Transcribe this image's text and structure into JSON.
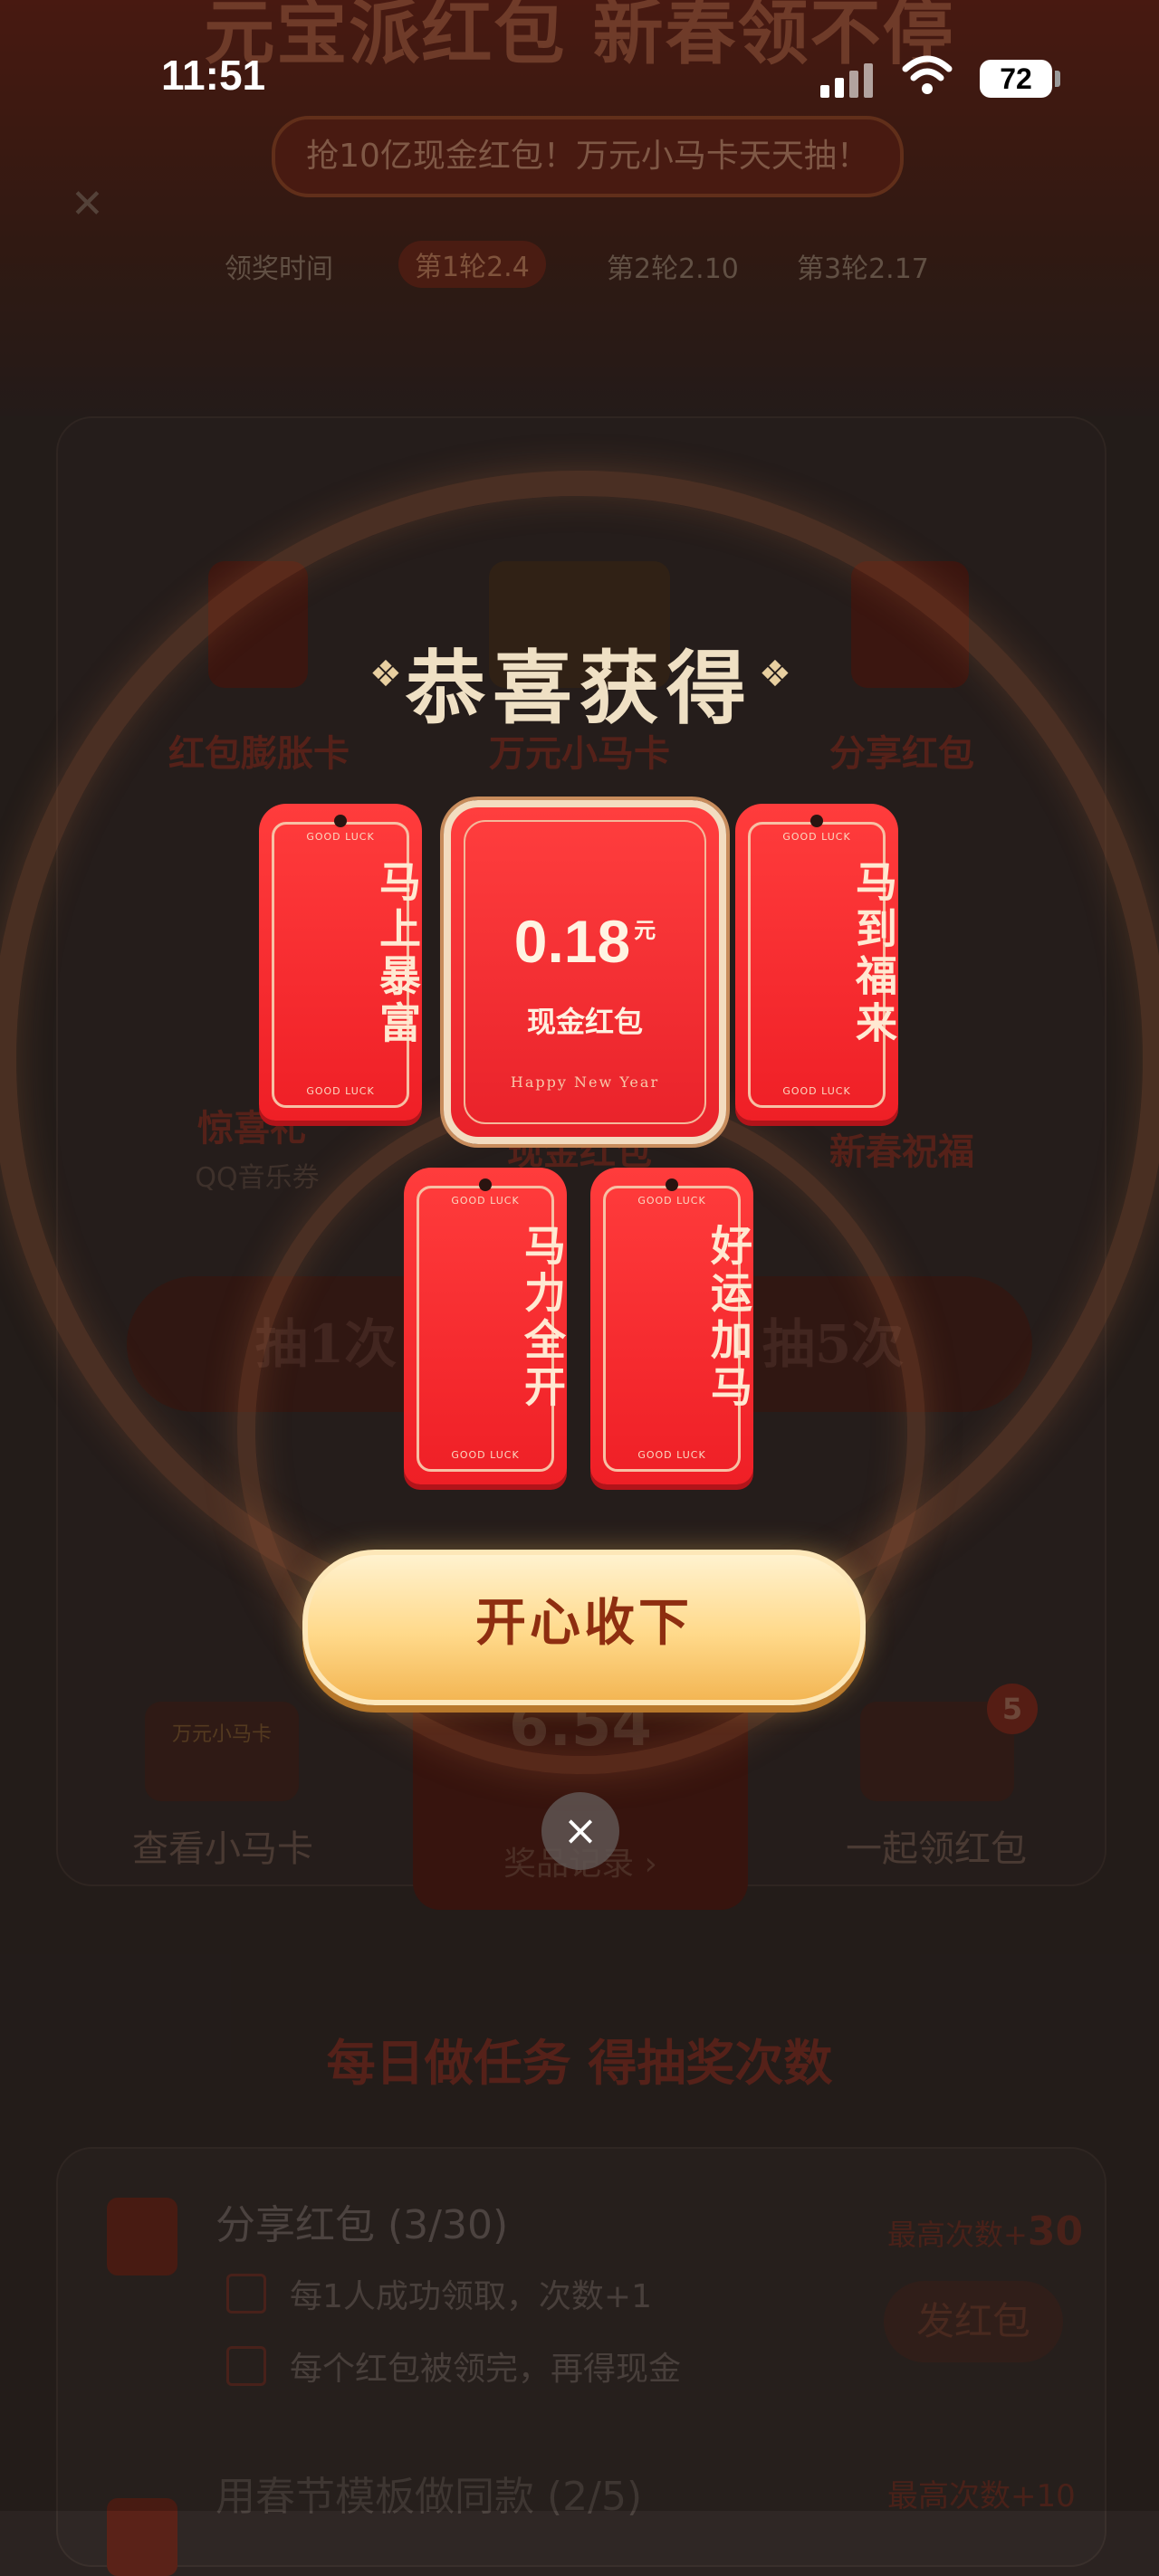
{
  "status_bar": {
    "time": "11:51",
    "battery": "72"
  },
  "background": {
    "hero_title": "元宝派红包 新春领不停",
    "hero_subtitle": "抢10亿现金红包！万元小马卡天天抽！",
    "rounds": {
      "label": "领奖时间",
      "round1": "第1轮2.4",
      "round2": "第2轮2.10",
      "round3": "第3轮2.17"
    },
    "grid": [
      {
        "label": "红包膨胀卡"
      },
      {
        "label": "万元小马卡"
      },
      {
        "label": "分享红包"
      },
      {
        "label": "惊喜礼",
        "sub": "QQ音乐券"
      },
      {
        "label": "现金红包"
      },
      {
        "label": "新春祝福"
      }
    ],
    "draw_once": "抽1次",
    "draw_five": "抽5次",
    "balance_value": "6.54",
    "balance_record": "奖品记录 ›",
    "view_card": "查看小马卡",
    "view_card_icon_text": "万元小马卡",
    "together": "一起领红包",
    "together_badge": "5",
    "daily_title": "每日做任务 得抽奖次数",
    "task1": {
      "title": "分享红包 (3/30)",
      "line1": "每1人成功领取，次数+1",
      "line2": "每个红包被领完，再得现金",
      "max_label": "最高次数+",
      "max_value": "30",
      "button": "发红包"
    },
    "task2": {
      "title": "用春节模板做同款 (2/5)",
      "max_label": "最高次数+10"
    }
  },
  "modal": {
    "title": "恭喜获得",
    "cash_amount": "0.18",
    "cash_unit": "元",
    "cash_label": "现金红包",
    "cash_footer": "Happy New Year",
    "tag_small_text": "GOOD LUCK",
    "tags": [
      "马上暴富",
      "马到福来",
      "马力全开",
      "好运加马"
    ],
    "accept_button": "开心收下",
    "close_icon": "×"
  }
}
